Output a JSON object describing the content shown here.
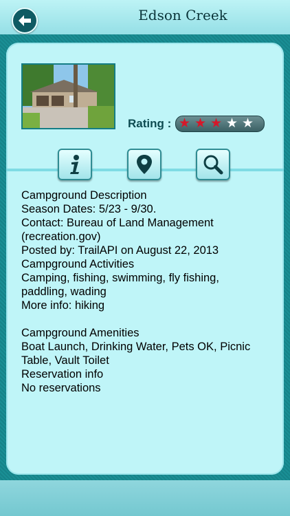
{
  "header": {
    "title": "Edson Creek"
  },
  "rating": {
    "label": "Rating :",
    "value": 3,
    "max": 5
  },
  "tabs": [
    {
      "icon": "info-icon"
    },
    {
      "icon": "map-pin-icon"
    },
    {
      "icon": "search-icon"
    }
  ],
  "description_lines": [
    "Campground Description",
    "Season Dates: 5/23 - 9/30.",
    "Contact: Bureau of Land Management",
    "(recreation.gov)",
    "Posted by: TrailAPI on August 22, 2013",
    "Campground Activities",
    "Camping, fishing, swimming, fly fishing,",
    "paddling, wading",
    "More info: hiking",
    "",
    "Campground Amenities",
    "Boat Launch, Drinking Water, Pets OK, Picnic",
    "Table, Vault Toilet",
    "Reservation info",
    "No reservations"
  ],
  "colors": {
    "accent": "#138a8f",
    "star_on": "#d5182a",
    "card": "#bff5f8"
  }
}
